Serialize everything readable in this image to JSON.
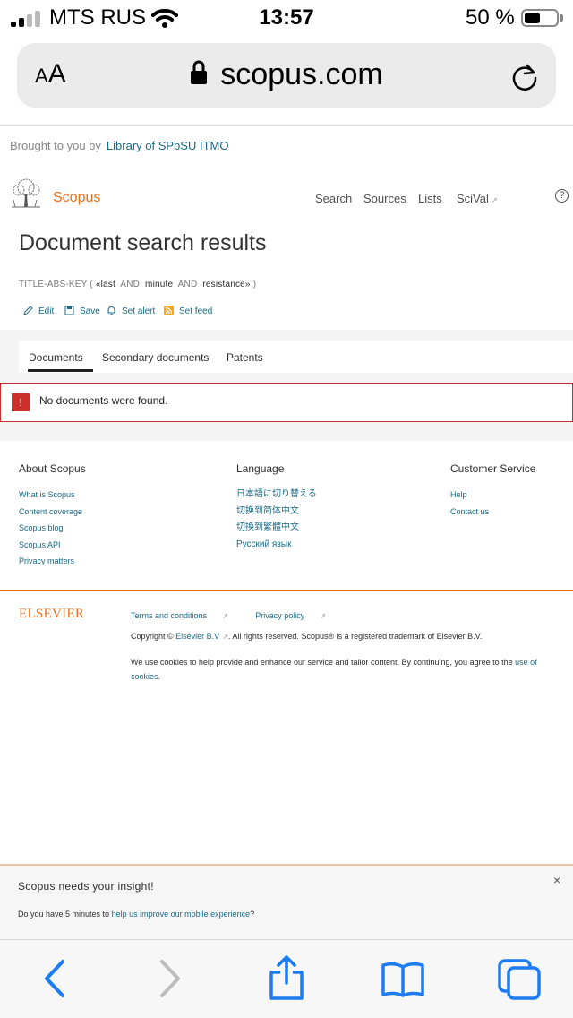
{
  "status_bar": {
    "carrier": "MTS RUS",
    "time": "13:57",
    "battery_percent": "50 %",
    "battery_level": 0.5,
    "signal_bars": 2
  },
  "browser": {
    "text_size_label_small": "A",
    "text_size_label_large": "A",
    "url": "scopus.com"
  },
  "page": {
    "brought_by_label": "Brought to you by",
    "institution": "Library of SPbSU ITMO",
    "brand": "Scopus",
    "nav": [
      "Search",
      "Sources",
      "Lists",
      "SciVal"
    ],
    "help_symbol": "?",
    "title": "Document search results",
    "query": {
      "field": "TITLE-ABS-KEY (",
      "term1": "«last",
      "op1": "AND",
      "term2": "minute",
      "op2": "AND",
      "term3": "resistance»",
      "close": ")"
    },
    "actions": [
      "Edit",
      "Save",
      "Set alert",
      "Set feed"
    ],
    "tabs": [
      "Documents",
      "Secondary documents",
      "Patents"
    ],
    "alert": {
      "symbol": "!",
      "message": "No documents were found."
    }
  },
  "footer": {
    "about": {
      "title": "About Scopus",
      "links": [
        "What is Scopus",
        "Content coverage",
        "Scopus blog",
        "Scopus API",
        "Privacy matters"
      ]
    },
    "language": {
      "title": "Language",
      "links": [
        "日本語に切り替える",
        "切换到简体中文",
        "切換到繁體中文",
        "Русский язык"
      ]
    },
    "service": {
      "title": "Customer Service",
      "links": [
        "Help",
        "Contact us"
      ]
    },
    "elsevier_logo": "ELSEVIER",
    "terms": "Terms and conditions",
    "privacy": "Privacy policy",
    "copyright_prefix": "Copyright ©",
    "copyright_link": "Elsevier B.V",
    "copyright_suffix": ". All rights reserved. Scopus® is a registered trademark of Elsevier B.V.",
    "cookies_text": "We use cookies to help provide and enhance our service and tailor content. By continuing, you agree to the",
    "cookies_link": "use of cookies",
    "cookies_end": "."
  },
  "banner": {
    "title": "Scopus needs your insight!",
    "close": "×",
    "text_prefix": "Do you have 5 minutes to",
    "link": "help us improve our mobile experience",
    "text_suffix": "?"
  },
  "colors": {
    "accent": "#e9711c",
    "link": "#1b6a86",
    "alert": "#c9302c",
    "ios_blue": "#1e7cf2"
  },
  "icons": {
    "toolbar": [
      "back-icon",
      "forward-icon",
      "share-icon",
      "bookmarks-icon",
      "tabs-icon"
    ]
  }
}
